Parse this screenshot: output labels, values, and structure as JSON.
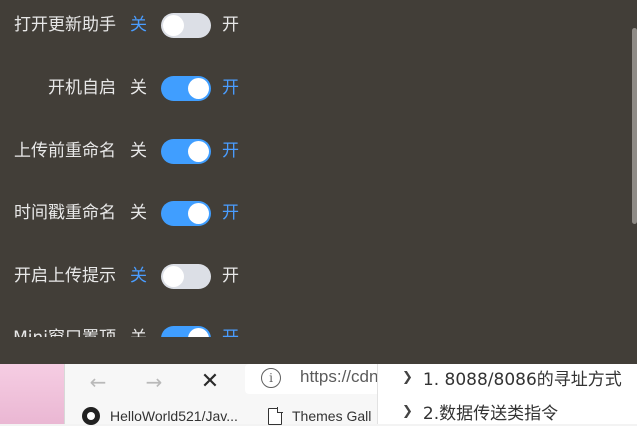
{
  "settings": {
    "switch_on_color": "#409eff",
    "switch_off_color": "#dcdfe6",
    "active_option_color": "#4a9dff",
    "rows": [
      {
        "label": "打开更新助手",
        "off_label": "关",
        "on_label": "开",
        "enabled": false
      },
      {
        "label": "开机自启",
        "off_label": "关",
        "on_label": "开",
        "enabled": true
      },
      {
        "label": "上传前重命名",
        "off_label": "关",
        "on_label": "开",
        "enabled": true
      },
      {
        "label": "时间戳重命名",
        "off_label": "关",
        "on_label": "开",
        "enabled": true
      },
      {
        "label": "开启上传提示",
        "off_label": "关",
        "on_label": "开",
        "enabled": false
      },
      {
        "label": "Mini窗口置顶",
        "off_label": "关",
        "on_label": "开",
        "enabled": true
      }
    ]
  },
  "browser": {
    "back_icon": "back-arrow-icon",
    "forward_icon": "forward-arrow-icon",
    "close_icon": "close-icon",
    "info_icon": "info-icon",
    "url": "https://cdn",
    "bookmarks": [
      {
        "icon": "github-icon",
        "label": "HelloWorld521/Jav..."
      },
      {
        "icon": "document-icon",
        "label": "Themes Gall"
      }
    ]
  },
  "toc": {
    "items": [
      {
        "label": "1. 8088/8086的寻址方式"
      },
      {
        "label": "2.数据传送类指令"
      }
    ]
  }
}
